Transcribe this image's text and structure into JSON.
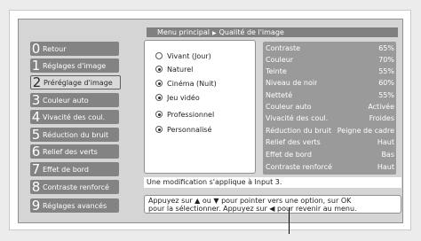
{
  "breadcrumb": {
    "root": "Menu principal",
    "separator": "▶",
    "current": "Qualité de l'image"
  },
  "menu": [
    {
      "num": "0",
      "label": "Retour"
    },
    {
      "num": "1",
      "label": "Réglages d'image"
    },
    {
      "num": "2",
      "label": "Préréglage d'image",
      "selected": true
    },
    {
      "num": "3",
      "label": "Couleur auto"
    },
    {
      "num": "4",
      "label": "Vivacité des coul."
    },
    {
      "num": "5",
      "label": "Réduction du bruit"
    },
    {
      "num": "6",
      "label": "Relief des verts"
    },
    {
      "num": "7",
      "label": "Effet de bord"
    },
    {
      "num": "8",
      "label": "Contraste renforcé"
    },
    {
      "num": "9",
      "label": "Réglages avancés"
    }
  ],
  "presets": [
    {
      "label": "Vivant (Jour)",
      "selected": false
    },
    {
      "label": "Naturel",
      "selected": true
    },
    {
      "label": "Cinéma (Nuit)",
      "selected": true
    },
    {
      "label": "Jeu vidéo",
      "selected": true
    },
    {
      "label": "Professionnel",
      "selected": true
    },
    {
      "label": "Personnalisé",
      "selected": true
    }
  ],
  "settings": [
    {
      "label": "Contraste",
      "value": "65%"
    },
    {
      "label": "Couleur",
      "value": "70%"
    },
    {
      "label": "Teinte",
      "value": "55%"
    },
    {
      "label": "Niveau de noir",
      "value": "60%"
    },
    {
      "label": "Netteté",
      "value": "55%"
    },
    {
      "label": "Couleur auto",
      "value": "Activée"
    },
    {
      "label": "Vivacité des coul.",
      "value": "Froides"
    },
    {
      "label": "Réduction du bruit",
      "value": "Peigne de cadre"
    },
    {
      "label": "Relief des verts",
      "value": "Haut"
    },
    {
      "label": "Effet de bord",
      "value": "Bas"
    },
    {
      "label": "Contraste renforcé",
      "value": "Haut"
    }
  ],
  "note": "Une modification s'applique à  Input 3.",
  "help": {
    "line1": "Appuyez sur ▲ ou ▼ pour pointer vers une option, sur OK",
    "line2": "pour la sélectionner. Appuyez sur ◀ pour revenir au menu."
  }
}
